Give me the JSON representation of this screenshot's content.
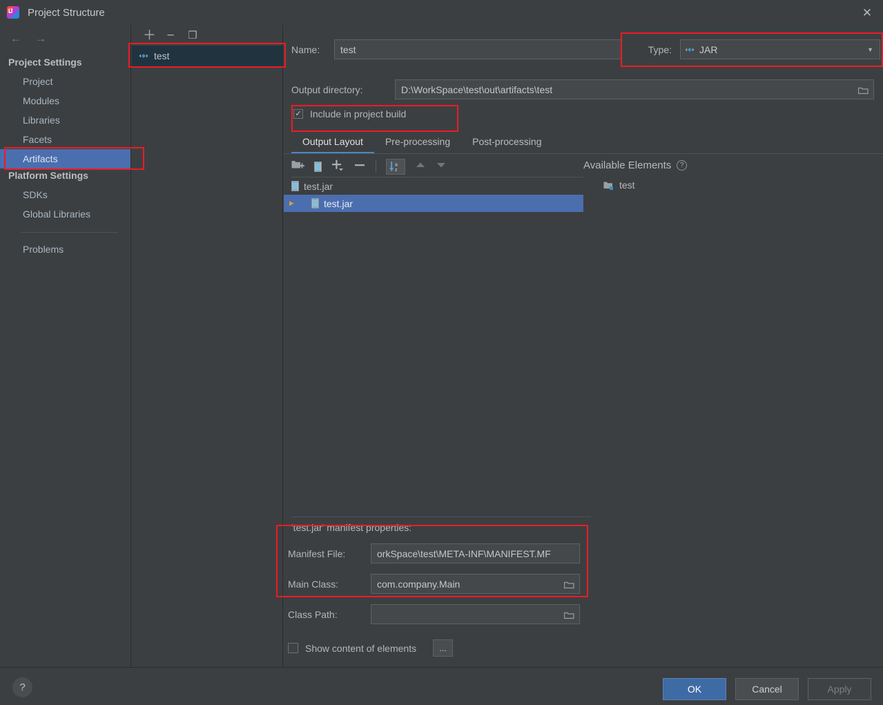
{
  "window": {
    "title": "Project Structure",
    "icon": "intellij-idea-logo",
    "close_label": "✕"
  },
  "sidebar": {
    "back_arrow": "←",
    "forward_arrow": "→",
    "groups": [
      {
        "label": "Project Settings",
        "items": [
          {
            "label": "Project",
            "selected": false
          },
          {
            "label": "Modules",
            "selected": false
          },
          {
            "label": "Libraries",
            "selected": false
          },
          {
            "label": "Facets",
            "selected": false
          },
          {
            "label": "Artifacts",
            "selected": true
          }
        ]
      },
      {
        "label": "Platform Settings",
        "items": [
          {
            "label": "SDKs",
            "selected": false
          },
          {
            "label": "Global Libraries",
            "selected": false
          }
        ]
      }
    ],
    "problems": {
      "label": "Problems"
    }
  },
  "artifacts_panel": {
    "toolbar": [
      {
        "name": "add-artifact-button",
        "glyph": "＋"
      },
      {
        "name": "remove-artifact-button",
        "glyph": "−"
      },
      {
        "name": "copy-artifact-button",
        "glyph": "❐"
      }
    ],
    "items": [
      {
        "label": "test",
        "icon": "artifact-diamond-icon",
        "selected": true
      }
    ]
  },
  "main": {
    "name_field": {
      "label": "Name:",
      "label_mnemonic": "a",
      "value": "test"
    },
    "type_field": {
      "label": "Type:",
      "value": "JAR",
      "icon": "artifact-diamond-icon",
      "arrow": "▼"
    },
    "output_directory": {
      "label": "Output directory:",
      "value": "D:\\WorkSpace\\test\\out\\artifacts\\test",
      "browse_icon": "folder-icon"
    },
    "include_in_build": {
      "label": "Include in project build",
      "checked": true,
      "check_glyph": "✓"
    },
    "tabs": [
      {
        "label": "Output Layout",
        "active": true
      },
      {
        "label": "Pre-processing",
        "active": false
      },
      {
        "label": "Post-processing",
        "active": false
      }
    ],
    "layout_toolbar": [
      {
        "name": "add-directory-button",
        "glyph": "folder-plus-icon"
      },
      {
        "name": "add-archive-button",
        "glyph": "jar-icon"
      },
      {
        "name": "add-element-button",
        "glyph": "plus-dropdown-icon"
      },
      {
        "name": "remove-element-button",
        "glyph": "minus-icon"
      },
      {
        "name": "sort-alphabetically-button",
        "glyph": "sort-az-icon"
      },
      {
        "name": "move-up-button",
        "glyph": "arrow-up-icon"
      },
      {
        "name": "move-down-button",
        "glyph": "arrow-down-icon"
      }
    ],
    "output_tree": [
      {
        "label": "test.jar",
        "icon": "jar-icon",
        "indent": 0,
        "expander": "",
        "selected": false
      },
      {
        "label": "test.jar",
        "icon": "jar-icon",
        "indent": 1,
        "expander": "▶",
        "selected": true
      }
    ],
    "available_elements": {
      "title": "Available Elements",
      "help_glyph": "?",
      "items": [
        {
          "label": "test",
          "icon": "module-folder-icon"
        }
      ]
    },
    "manifest_section": {
      "title": "'test.jar' manifest properties:",
      "manifest_file": {
        "label": "Manifest File:",
        "value": "orkSpace\\test\\META-INF\\MANIFEST.MF"
      },
      "main_class": {
        "label": "Main Class:",
        "value": "com.company.Main",
        "browse_icon": "folder-icon"
      },
      "class_path": {
        "label": "Class Path:",
        "value": "",
        "browse_icon": "folder-icon"
      }
    },
    "show_content": {
      "label": "Show content of elements",
      "checked": false,
      "more_button": "..."
    }
  },
  "footer": {
    "help_glyph": "?",
    "ok": "OK",
    "cancel": "Cancel",
    "apply": "Apply"
  },
  "colors": {
    "background": "#3c3f41",
    "selection_blue": "#4b6eaf",
    "artifact_selection": "#20333f",
    "accent_tab": "#4a88c7",
    "annotation_red": "#ee1b24",
    "field_bg": "#45484a"
  }
}
